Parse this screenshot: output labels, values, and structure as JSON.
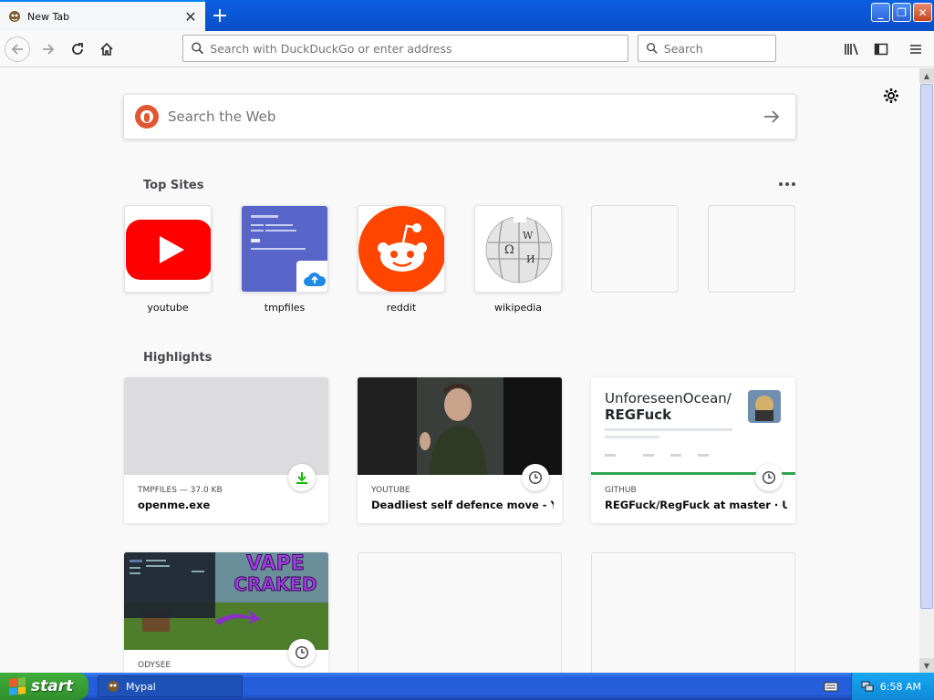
{
  "browser": {
    "tab_title": "New Tab",
    "tab_close_icon": "close-icon",
    "new_tab_icon": "plus-icon"
  },
  "window_controls": [
    "minimize-icon",
    "restore-icon",
    "close-icon"
  ],
  "navbar": {
    "url_placeholder": "Search with DuckDuckGo or enter address",
    "search_placeholder": "Search"
  },
  "newtab": {
    "search_placeholder": "Search the Web",
    "top_sites_heading": "Top Sites",
    "highlights_heading": "Highlights",
    "top_sites": [
      {
        "label": "youtube"
      },
      {
        "label": "tmpfiles"
      },
      {
        "label": "reddit"
      },
      {
        "label": "wikipedia"
      },
      {
        "label": ""
      },
      {
        "label": ""
      }
    ],
    "highlights": [
      {
        "source": "TMPFILES — 37.0 KB",
        "title": "openme.exe",
        "badge": "download-icon"
      },
      {
        "source": "YOUTUBE",
        "title": "Deadliest self defence move - Y…",
        "badge": "clock-icon"
      },
      {
        "source": "GITHUB",
        "title": "REGFuck/RegFuck at master · U…",
        "badge": "clock-icon"
      },
      {
        "source": "ODYSEE",
        "title": "",
        "badge": "clock-icon"
      }
    ],
    "github_thumb": {
      "title": "UnforeseenOcean/",
      "subtitle": "REGFuck"
    },
    "odysee_thumb": {
      "line1": "VAPE",
      "line2": "CRAKED"
    }
  },
  "taskbar": {
    "start_label": "start",
    "task_label": "Mypal",
    "clock": "6:58 AM"
  },
  "colors": {
    "accent": "#0a84ff",
    "youtube": "#ff0000",
    "reddit": "#ff4500",
    "tmpfiles": "#5865c9",
    "taskbar": "#245edb",
    "start": "#3fae3b"
  }
}
